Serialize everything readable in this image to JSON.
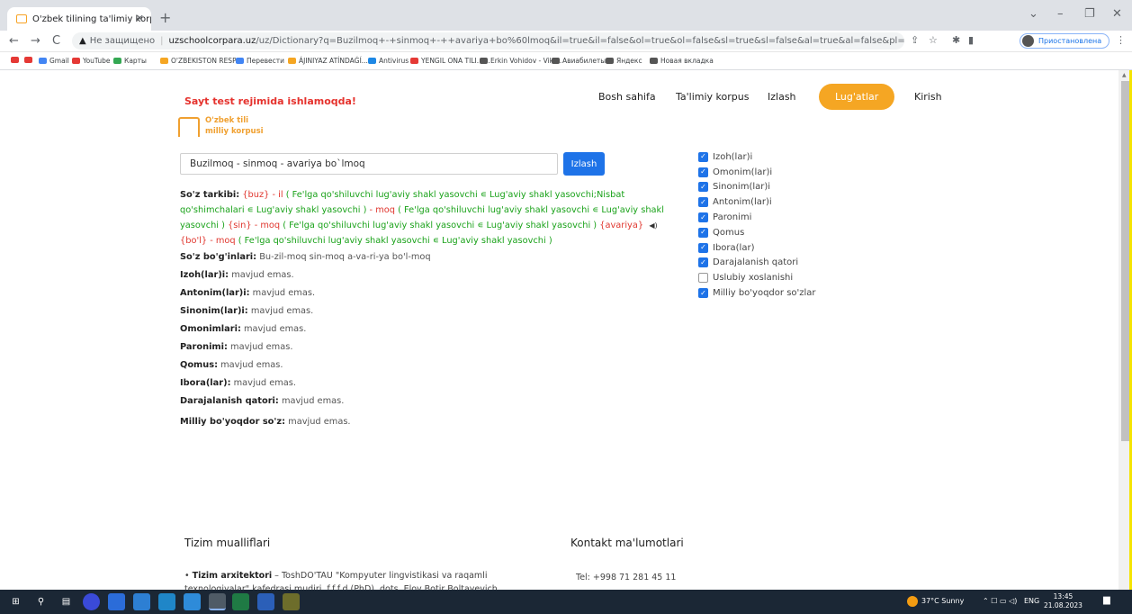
{
  "browser": {
    "tab_title": "O'zbek tilining ta'limiy korpusi",
    "tab_close": "✕",
    "new_tab": "+",
    "win_down": "⌄",
    "win_min": "–",
    "win_max": "❐",
    "win_close": "✕",
    "back": "←",
    "forward": "→",
    "reload": "C",
    "insecure_label": "Не защищено",
    "url_host": "uzschoolcorpara.uz",
    "url_path": "/uz/Dictionary?q=Buzilmoq+-+sinmoq+-++avariya+bo%60lmoq&il=true&il=false&ol=true&ol=false&sl=true&sl=false&al=true&al=false&pl=true&pl=false&qo=false&qo=true&ib=true&ib=fals...",
    "profile_label": "Приостановлена",
    "menu": "⋮"
  },
  "bookmarks": [
    {
      "label": "",
      "color": "#e53935"
    },
    {
      "label": "",
      "color": "#e53935"
    },
    {
      "label": "Gmail",
      "color": "#4285f4"
    },
    {
      "label": "YouTube",
      "color": "#e53935"
    },
    {
      "label": "Карты",
      "color": "#34a853"
    },
    {
      "label": "O'ZBEKISTON RESP...",
      "color": "#f5a623"
    },
    {
      "label": "Перевести",
      "color": "#4285f4"
    },
    {
      "label": "ÁJINIYAZ ATÍNDAǴÍ...",
      "color": "#f5a623"
    },
    {
      "label": "Antivirus",
      "color": "#1e88e5"
    },
    {
      "label": "YENGIL ONA TILI. F...",
      "color": "#e53935"
    },
    {
      "label": "Erkin Vohidov - Viki...",
      "color": "#555555"
    },
    {
      "label": "Авиабилеты",
      "color": "#555555"
    },
    {
      "label": "Яндекс",
      "color": "#555555"
    },
    {
      "label": "Новая вкладка",
      "color": "#555555"
    }
  ],
  "header": {
    "banner": "Sayt test rejimida ishlamoqda!",
    "logo_line1": "O'zbek tili",
    "logo_line2": "milliy korpusi",
    "nav": [
      "Bosh sahifa",
      "Ta'limiy korpus",
      "Izlash",
      "Lug'atlar",
      "Kirish"
    ],
    "active_nav": "Lug'atlar"
  },
  "search": {
    "value": "Buzilmoq - sinmoq  -  avariya bo`lmoq",
    "button": "Izlash"
  },
  "filters": [
    {
      "label": "Izoh(lar)i",
      "checked": true
    },
    {
      "label": "Omonim(lar)i",
      "checked": true
    },
    {
      "label": "Sinonim(lar)i",
      "checked": true
    },
    {
      "label": "Antonim(lar)i",
      "checked": true
    },
    {
      "label": "Paronimi",
      "checked": true
    },
    {
      "label": "Qomus",
      "checked": true
    },
    {
      "label": "Ibora(lar)",
      "checked": true
    },
    {
      "label": "Darajalanish qatori",
      "checked": true
    },
    {
      "label": "Uslubiy xoslanishi",
      "checked": false
    },
    {
      "label": "Milliy bo'yoqdor so'zlar",
      "checked": true
    }
  ],
  "result": {
    "tarkib_label": "So'z tarkibi:",
    "t1": "{buz}",
    "t2": " - il ",
    "t3": "( Fe'lga qo'shiluvchi lug'aviy shakl yasovchi ∊ Lug'aviy shakl yasovchi;Nisbat qo'shimchalari ∊ Lug'aviy shakl yasovchi )",
    "t4": " - moq ",
    "t5": "( Fe'lga qo'shiluvchi lug'aviy shakl yasovchi ∊ Lug'aviy shakl yasovchi )",
    "t6": " {sin}",
    "t7": " - moq ",
    "t8": "( Fe'lga qo'shiluvchi lug'aviy shakl yasovchi ∊ Lug'aviy shakl yasovchi )",
    "t9": " {avariya}",
    "t10": "{bo'l}",
    "t11": " - moq ",
    "t12": "( Fe'lga qo'shiluvchi lug'aviy shakl yasovchi ∊ Lug'aviy shakl yasovchi )",
    "speaker": "◀)",
    "bogin_label": "So'z bo'g'inlari:",
    "bogin_value": " Bu-zil-moq sin-moq a-va-ri-ya bo'l-moq",
    "rows": [
      {
        "label": "Izoh(lar)i:",
        "value": " mavjud emas."
      },
      {
        "label": "Antonim(lar)i:",
        "value": " mavjud emas."
      },
      {
        "label": "Sinonim(lar)i:",
        "value": " mavjud emas."
      },
      {
        "label": "Omonimlari:",
        "value": " mavjud emas."
      },
      {
        "label": "Paronimi:",
        "value": " mavjud emas."
      },
      {
        "label": "Qomus:",
        "value": " mavjud emas."
      },
      {
        "label": "Ibora(lar):",
        "value": " mavjud emas."
      },
      {
        "label": "Darajalanish qatori:",
        "value": " mavjud emas."
      },
      {
        "label": "Milliy bo'yoqdor so'z:",
        "value": " mavjud emas."
      }
    ]
  },
  "footer": {
    "authors_heading": "Tizim mualliflari",
    "contacts_heading": "Kontakt ma'lumotlari",
    "author1_role": "Tizim arxitektori",
    "author1_text": " – ToshDO'TAU \"Kompyuter lingvistikasi va raqamli texnologiyalar\" kafedrasi mudiri, f.f.f.d.(PhD), dots. Elov Botir Boltayevich.",
    "tel": "Tel: +998 71 281 45 11"
  },
  "taskbar": {
    "weather": "37°C Sunny",
    "lang": "ENG",
    "time": "13:45",
    "date": "21.08.2023"
  }
}
